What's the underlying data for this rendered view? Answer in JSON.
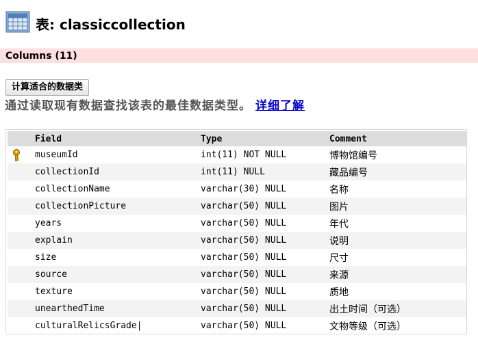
{
  "header": {
    "title": "表: classiccollection",
    "icon": "table-grid-icon"
  },
  "columns_bar": {
    "label": "Columns (11)"
  },
  "suggest_button": {
    "label": "计算适合的数据类"
  },
  "description": {
    "text": "通过读取现有数据查找该表的最佳数据类型。",
    "link": "详细了解"
  },
  "table": {
    "headers": [
      "Field",
      "Type",
      "Comment"
    ],
    "rows": [
      {
        "key": true,
        "field": "museumId",
        "type": "int(11) NOT NULL",
        "comment": "博物馆编号"
      },
      {
        "key": false,
        "field": "collectionId",
        "type": "int(11) NULL",
        "comment": "藏品编号"
      },
      {
        "key": false,
        "field": "collectionName",
        "type": "varchar(30) NULL",
        "comment": "名称"
      },
      {
        "key": false,
        "field": "collectionPicture",
        "type": "varchar(50) NULL",
        "comment": "图片"
      },
      {
        "key": false,
        "field": "years",
        "type": "varchar(50) NULL",
        "comment": "年代"
      },
      {
        "key": false,
        "field": "explain",
        "type": "varchar(50) NULL",
        "comment": "说明"
      },
      {
        "key": false,
        "field": "size",
        "type": "varchar(50) NULL",
        "comment": "尺寸"
      },
      {
        "key": false,
        "field": "source",
        "type": "varchar(50) NULL",
        "comment": "来源"
      },
      {
        "key": false,
        "field": "texture",
        "type": "varchar(50) NULL",
        "comment": "质地"
      },
      {
        "key": false,
        "field": "unearthedTime",
        "type": "varchar(50) NULL",
        "comment": "出土时间（可选）"
      },
      {
        "key": false,
        "field": "culturalRelicsGrade|",
        "type": "varchar(50) NULL",
        "comment": "文物等级（可选）"
      }
    ]
  },
  "colors": {
    "columns_bar_bg": "#ffe0e0",
    "link": "#0000cc",
    "row_alt": "#f3f3f3",
    "header_bg": "#dcdcdc",
    "key": "#e0a000"
  }
}
